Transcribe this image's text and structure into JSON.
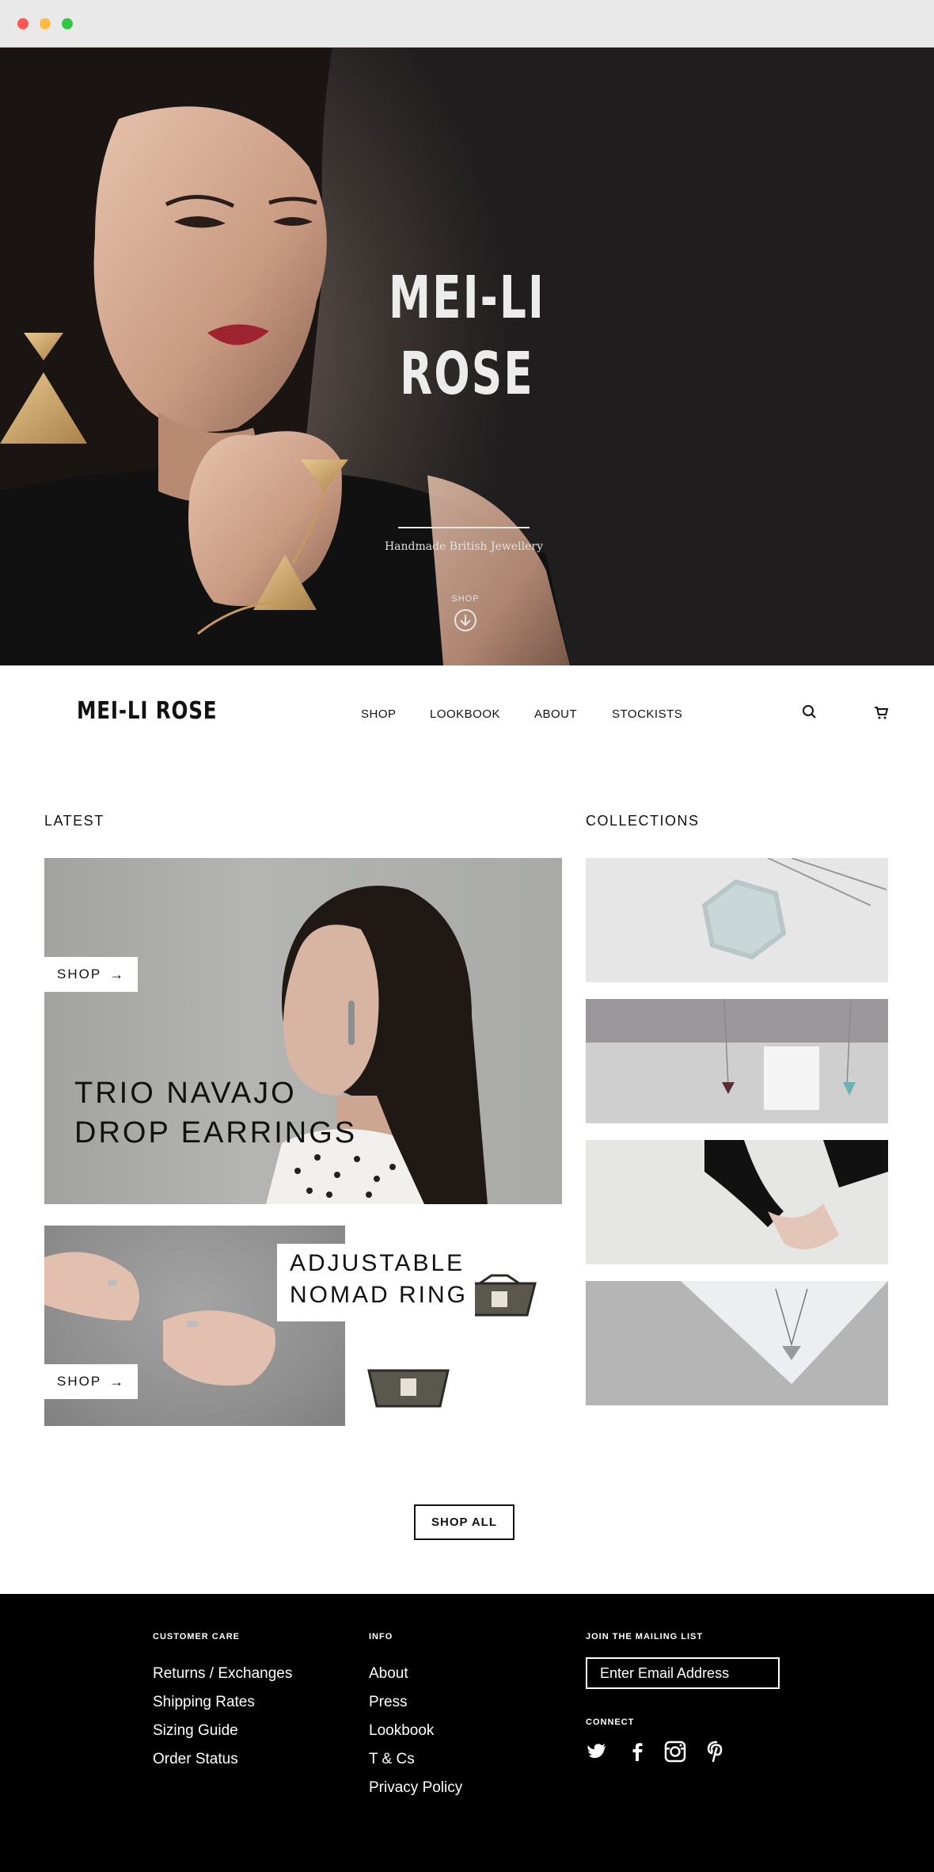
{
  "hero": {
    "title_line1": "MEI-LI",
    "title_line2": "ROSE",
    "tagline": "Handmade British Jewellery",
    "shop_label": "SHOP",
    "shop_icon": "arrow-down-circle-icon"
  },
  "nav": {
    "logo": "MEI-LI ROSE",
    "links": [
      "SHOP",
      "LOOKBOOK",
      "ABOUT",
      "STOCKISTS"
    ],
    "search_icon": "search-icon",
    "cart_icon": "cart-icon"
  },
  "latest": {
    "heading": "LATEST",
    "trio": {
      "title_line1": "TRIO NAVAJO",
      "title_line2": "DROP EARRINGS",
      "shop_label": "SHOP"
    },
    "nomad": {
      "title_line1": "ADJUSTABLE",
      "title_line2": "NOMAD RING",
      "shop_label": "SHOP"
    }
  },
  "collections": {
    "heading": "COLLECTIONS"
  },
  "shop_all": "SHOP ALL",
  "footer": {
    "customer_care": {
      "heading": "CUSTOMER CARE",
      "items": [
        "Returns / Exchanges",
        "Shipping Rates",
        "Sizing Guide",
        "Order Status"
      ]
    },
    "info": {
      "heading": "INFO",
      "items": [
        "About",
        "Press",
        "Lookbook",
        "T & Cs",
        "Privacy Policy"
      ]
    },
    "mailing": {
      "heading": "JOIN THE MAILING LIST",
      "placeholder": "Enter Email Address"
    },
    "connect": {
      "heading": "CONNECT",
      "icons": [
        "twitter-icon",
        "facebook-icon",
        "instagram-icon",
        "pinterest-icon"
      ]
    }
  },
  "colors": {
    "footer_bg": "#000000",
    "hero_text": "#ececec",
    "accent": "#111111"
  }
}
